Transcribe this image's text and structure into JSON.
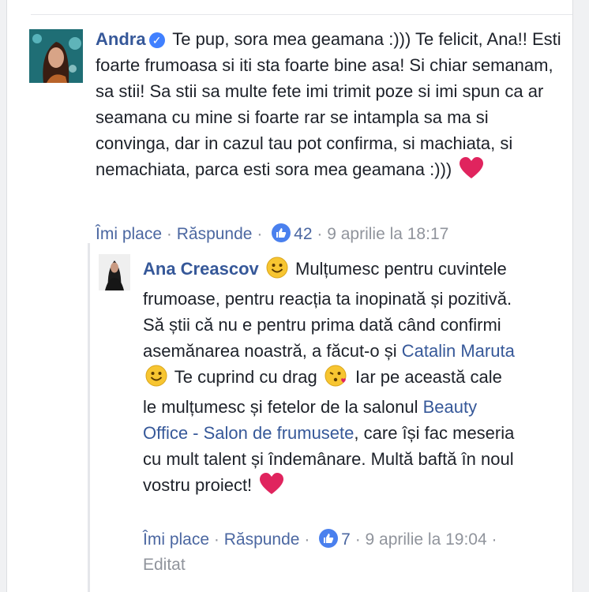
{
  "comment": {
    "author": "Andra",
    "body": "Te pup, sora mea geamana :))) Te felicit, Ana!! Esti foarte frumoasa si iti sta foarte bine asa! Si chiar semanam, sa stii! Sa stii sa multe fete imi trimit poze si imi spun ca ar seamana cu mine si foarte rar se intampla sa ma si convinga, dar in cazul tau pot confirma, si machiata, si nemachiata, parca esti sora mea geamana :)))",
    "like_label": "Îmi place",
    "reply_label": "Răspunde",
    "reaction_count": "42",
    "timestamp": "9 aprilie la 18:17",
    "verified_icon": "verified-check-icon"
  },
  "reply": {
    "author": "Ana Creascov",
    "part1": "Mulțumesc pentru cuvintele frumoase, pentru reacția ta inopinată și pozitivă. Să știi că nu e pentru prima dată când confirmi asemănarea noastră, a făcut-o și",
    "mention1": "Catalin Maruta",
    "part2": "Te cuprind cu drag",
    "part3": "Iar pe această cale le mulțumesc și fetelor de la salonul",
    "mention2": "Beauty Office - Salon de frumusete",
    "part4": ", care își fac meseria cu mult talent și îndemânare. Multă baftă în noul vostru proiect!",
    "like_label": "Îmi place",
    "reply_label": "Răspunde",
    "reaction_count": "7",
    "timestamp": "9 aprilie la 19:04",
    "edited": "Editat"
  },
  "colors": {
    "link": "#365899",
    "meta": "#90949c",
    "like": "#4a80ee",
    "heart": "#e0245e"
  }
}
